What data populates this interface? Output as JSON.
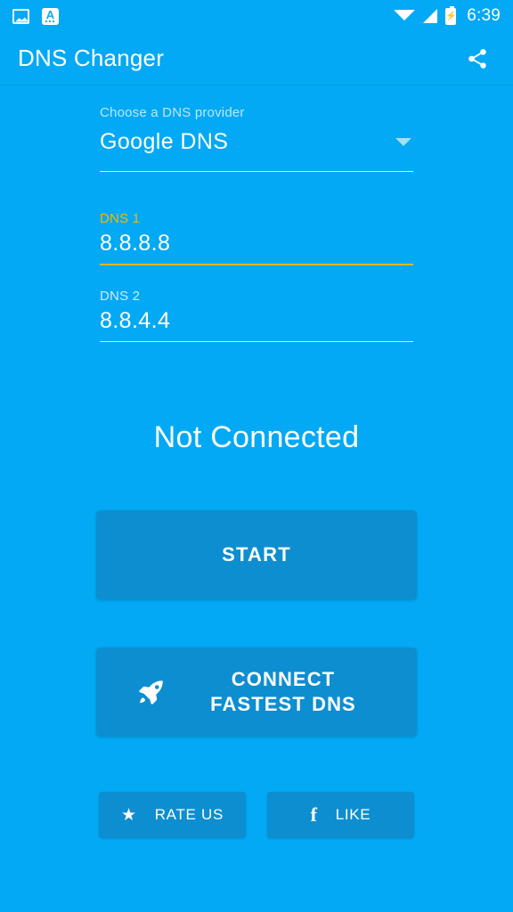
{
  "status_bar": {
    "icons_left": [
      "photo-icon",
      "keyboard-language-icon"
    ],
    "icons_right": [
      "wifi-icon",
      "cellular-signal-icon",
      "battery-charging-icon"
    ],
    "time": "6:39"
  },
  "app_bar": {
    "title": "DNS Changer",
    "share_icon": "share-icon"
  },
  "form": {
    "provider": {
      "label": "Choose a DNS provider",
      "value": "Google DNS",
      "caret_icon": "chevron-down-icon"
    },
    "dns1": {
      "label": "DNS 1",
      "value": "8.8.8.8",
      "focused": true
    },
    "dns2": {
      "label": "DNS 2",
      "value": "8.8.4.4",
      "focused": false
    }
  },
  "status": {
    "text": "Not Connected"
  },
  "actions": {
    "start_label": "START",
    "fastest_label": "CONNECT FASTEST DNS",
    "fastest_icon": "rocket-icon",
    "rate_label": "RATE US",
    "rate_icon": "star-icon",
    "like_label": "LIKE",
    "like_icon": "facebook-icon"
  },
  "colors": {
    "background": "#03a9f4",
    "button": "#0d8ed0",
    "accent_focus": "#f5b800",
    "text_primary": "#ffffff",
    "text_hint": "#bde7fb"
  }
}
